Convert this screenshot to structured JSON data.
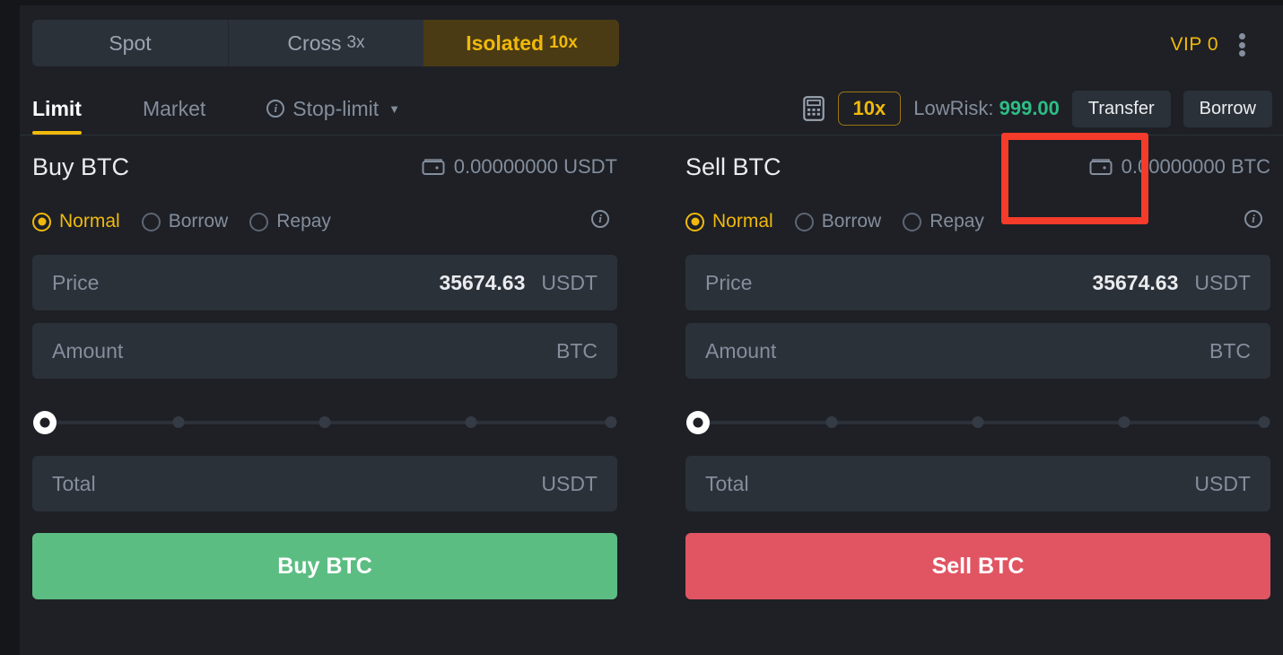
{
  "margin_modes": {
    "tabs": [
      {
        "label": "Spot",
        "leverage": "",
        "active": false
      },
      {
        "label": "Cross",
        "leverage": "3x",
        "active": false
      },
      {
        "label": "Isolated",
        "leverage": "10x",
        "active": true
      }
    ]
  },
  "account": {
    "vip_label": "VIP 0",
    "more_icon": "kebab-menu-icon"
  },
  "order_types": {
    "tabs": [
      {
        "label": "Limit",
        "active": true,
        "has_info": false,
        "has_caret": false
      },
      {
        "label": "Market",
        "active": false,
        "has_info": false,
        "has_caret": false
      },
      {
        "label": "Stop-limit",
        "active": false,
        "has_info": true,
        "has_caret": true
      }
    ]
  },
  "margin_bar": {
    "calculator_icon": "calculator-icon",
    "leverage_badge": "10x",
    "risk_label": "LowRisk:",
    "risk_value": "999.00",
    "transfer_label": "Transfer",
    "borrow_label": "Borrow",
    "highlight_color": "#f53b2a"
  },
  "buy": {
    "title": "Buy BTC",
    "wallet_icon": "wallet-icon",
    "balance": "0.00000000 USDT",
    "modes": [
      {
        "label": "Normal",
        "selected": true
      },
      {
        "label": "Borrow",
        "selected": false
      },
      {
        "label": "Repay",
        "selected": false
      }
    ],
    "info_icon": "info-icon",
    "price": {
      "label": "Price",
      "value": "35674.63",
      "unit": "USDT",
      "placeholder": "Price"
    },
    "amount": {
      "label": "Amount",
      "value": "",
      "unit": "BTC",
      "placeholder": "Amount"
    },
    "slider": {
      "percent": 0,
      "notches": [
        25,
        50,
        75,
        100
      ]
    },
    "total": {
      "label": "Total",
      "value": "",
      "unit": "USDT",
      "placeholder": "Total"
    },
    "submit_label": "Buy BTC",
    "submit_color": "#5cbd82"
  },
  "sell": {
    "title": "Sell BTC",
    "wallet_icon": "wallet-icon",
    "balance": "0.00000000 BTC",
    "modes": [
      {
        "label": "Normal",
        "selected": true
      },
      {
        "label": "Borrow",
        "selected": false
      },
      {
        "label": "Repay",
        "selected": false
      }
    ],
    "info_icon": "info-icon",
    "price": {
      "label": "Price",
      "value": "35674.63",
      "unit": "USDT",
      "placeholder": "Price"
    },
    "amount": {
      "label": "Amount",
      "value": "",
      "unit": "BTC",
      "placeholder": "Amount"
    },
    "slider": {
      "percent": 0,
      "notches": [
        25,
        50,
        75,
        100
      ]
    },
    "total": {
      "label": "Total",
      "value": "",
      "unit": "USDT",
      "placeholder": "Total"
    },
    "submit_label": "Sell BTC",
    "submit_color": "#e15563"
  }
}
